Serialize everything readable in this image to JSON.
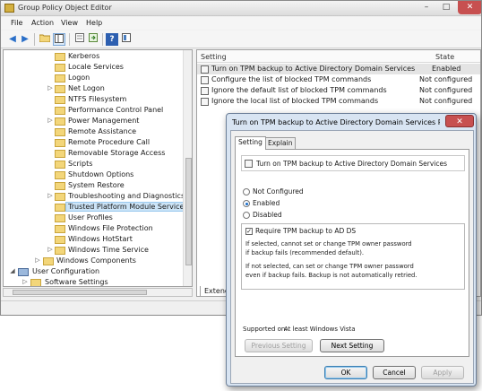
{
  "window": {
    "title": "Group Policy Object Editor",
    "minimize": "–",
    "maximize": "□",
    "close": "✕"
  },
  "menu": [
    "File",
    "Action",
    "View",
    "Help"
  ],
  "toolbar": {
    "back": "◀",
    "forward": "▶",
    "help": "?"
  },
  "tree": {
    "items": [
      {
        "label": "Kerberos",
        "expander": ""
      },
      {
        "label": "Locale Services",
        "expander": ""
      },
      {
        "label": "Logon",
        "expander": ""
      },
      {
        "label": "Net Logon",
        "expander": "▷"
      },
      {
        "label": "NTFS Filesystem",
        "expander": ""
      },
      {
        "label": "Performance Control Panel",
        "expander": ""
      },
      {
        "label": "Power Management",
        "expander": "▷"
      },
      {
        "label": "Remote Assistance",
        "expander": ""
      },
      {
        "label": "Remote Procedure Call",
        "expander": ""
      },
      {
        "label": "Removable Storage Access",
        "expander": ""
      },
      {
        "label": "Scripts",
        "expander": ""
      },
      {
        "label": "Shutdown Options",
        "expander": ""
      },
      {
        "label": "System Restore",
        "expander": ""
      },
      {
        "label": "Troubleshooting and Diagnostics",
        "expander": "▷"
      },
      {
        "label": "Trusted Platform Module Services",
        "expander": ""
      },
      {
        "label": "User Profiles",
        "expander": ""
      },
      {
        "label": "Windows File Protection",
        "expander": ""
      },
      {
        "label": "Windows HotStart",
        "expander": ""
      },
      {
        "label": "Windows Time Service",
        "expander": "▷"
      },
      {
        "label": "Windows Components",
        "expander": "▷"
      },
      {
        "label": "User Configuration",
        "expander": "◢"
      },
      {
        "label": "Software Settings",
        "expander": "▷"
      }
    ]
  },
  "list": {
    "columns": {
      "setting": "Setting",
      "state": "State"
    },
    "rows": [
      {
        "name": "Turn on TPM backup to Active Directory Domain Services",
        "state": "Enabled"
      },
      {
        "name": "Configure the list of blocked TPM commands",
        "state": "Not configured"
      },
      {
        "name": "Ignore the default list of blocked TPM commands",
        "state": "Not configured"
      },
      {
        "name": "Ignore the local list of blocked TPM commands",
        "state": "Not configured"
      }
    ],
    "bottom_tab": "Extende"
  },
  "dialog": {
    "title": "Turn on TPM backup to Active Directory Domain Services Pr...",
    "close": "✕",
    "tabs": [
      "Setting",
      "Explain"
    ],
    "policy_name": "Turn on TPM backup to Active Directory Domain Services",
    "options": [
      "Not Configured",
      "Enabled",
      "Disabled"
    ],
    "selected_option": "Enabled",
    "checkbox": {
      "label": "Require TPM backup to AD DS",
      "checked": true,
      "mark": "✓"
    },
    "notes": [
      "If selected, cannot set or change TPM owner password",
      "if backup fails (recommended default).",
      "If not selected, can set or change TPM owner password",
      "even if backup fails. Backup is not automatically retried."
    ],
    "supported_label": "Supported on:",
    "supported_value": "At least Windows Vista",
    "buttons": {
      "previous": "Previous Setting",
      "next": "Next Setting",
      "ok": "OK",
      "cancel": "Cancel",
      "apply": "Apply"
    }
  }
}
